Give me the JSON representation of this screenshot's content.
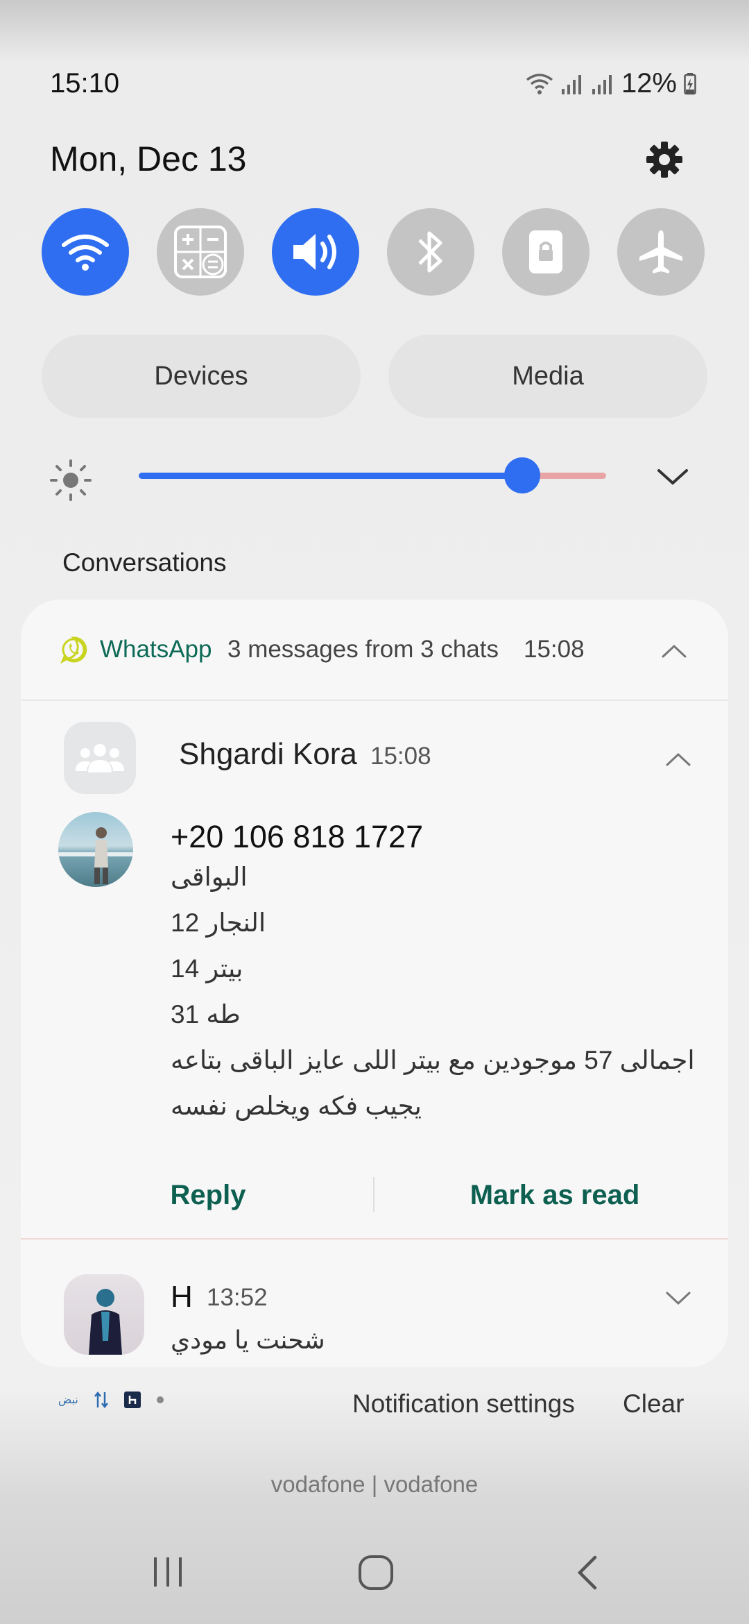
{
  "status_bar": {
    "time": "15:10",
    "battery": "12%"
  },
  "header": {
    "date": "Mon, Dec 13",
    "settings_icon": "gear-icon"
  },
  "quick_settings": [
    {
      "name": "wifi",
      "icon": "wifi-icon",
      "state": "on"
    },
    {
      "name": "calculator",
      "icon": "calculator-icon",
      "state": "off"
    },
    {
      "name": "sound",
      "icon": "volume-icon",
      "state": "on"
    },
    {
      "name": "bluetooth",
      "icon": "bluetooth-icon",
      "state": "off"
    },
    {
      "name": "rotation-lock",
      "icon": "lock-icon",
      "state": "off"
    },
    {
      "name": "airplane-mode",
      "icon": "airplane-icon",
      "state": "off"
    }
  ],
  "panels": {
    "devices_label": "Devices",
    "media_label": "Media"
  },
  "brightness": {
    "level": 0.82
  },
  "conversations": {
    "title": "Conversations",
    "app_name": "WhatsApp",
    "summary": "3 messages from 3 chats",
    "time": "15:08",
    "group": {
      "name": "Shgardi Kora",
      "time": "15:08",
      "sender": "+20 106 818 1727",
      "lines": [
        "البواقى",
        "النجار 12",
        "بيتر 14",
        "طه 31",
        "اجمالى 57 موجودين مع بيتر اللى عايز الباقى بتاعه",
        "يجيب فكه ويخلص نفسه"
      ],
      "reply_label": "Reply",
      "mark_read_label": "Mark as read"
    },
    "second": {
      "name": "H",
      "time": "13:52",
      "message": "شحنت يا مودي"
    }
  },
  "footer": {
    "mini_app_label": "نبض",
    "notification_settings_label": "Notification settings",
    "clear_label": "Clear",
    "carrier": "vodafone | vodafone"
  },
  "colors": {
    "accent": "#2f6ef0",
    "whatsapp_green": "#0d6a57",
    "toggle_off": "#c4c4c4"
  }
}
